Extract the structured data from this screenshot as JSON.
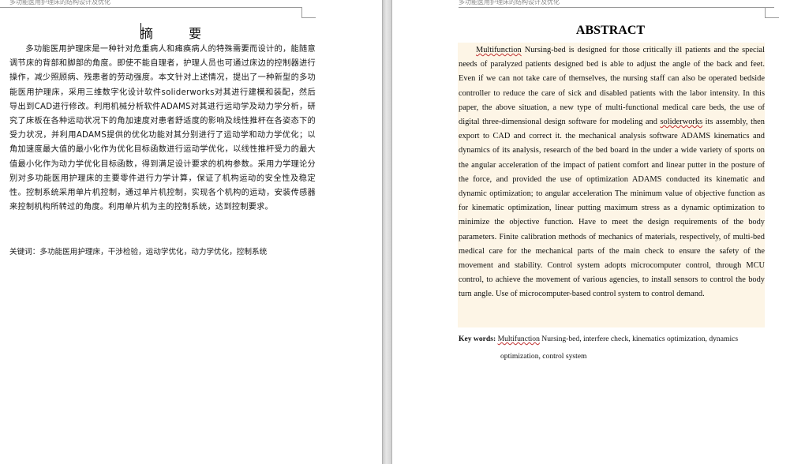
{
  "left_page": {
    "header": "多功能医用护理床的结构设计及优化",
    "title": "摘  要",
    "body": "多功能医用护理床是一种针对危重病人和瘫痪病人的特殊需要而设计的，能随意调节床的背部和脚部的角度。即使不能自理者，护理人员也可通过床边的控制器进行操作，减少照顾病、残患者的劳动强度。本文针对上述情况，提出了一种新型的多功能医用护理床，采用三维数字化设计软件soliderworks对其进行建模和装配，然后导出到CAD进行修改。利用机械分析软件ADAMS对其进行运动学及动力学分析，研究了床板在各种运动状况下的角加速度对患者舒适度的影响及线性推杆在各姿态下的受力状况，并利用ADAMS提供的优化功能对其分别进行了运动学和动力学优化；以角加速度最大值的最小化作为优化目标函数进行运动学优化，以线性推杆受力的最大值最小化作为动力学优化目标函数，得到满足设计要求的机构参数。采用力学理论分别对多功能医用护理床的主要零件进行力学计算，保证了机构运动的安全性及稳定性。控制系统采用单片机控制，通过单片机控制，实现各个机构的运动，安装传感器来控制机构所转过的角度。利用单片机为主的控制系统，达到控制要求。",
    "keywords": "关键词：多功能医用护理床，干涉检验，运动学优化，动力学优化，控制系统"
  },
  "right_page": {
    "header": "多功能医用护理床的结构设计及优化",
    "title": "ABSTRACT",
    "body_first_word": "Multifunction",
    "body_rest_1": " Nursing-bed is designed for those critically ill patients and the special needs of paralyzed patients designed bed is able to adjust the angle of the back and feet. Even if we can not take care of themselves, the nursing staff can also be operated bedside controller to reduce the care of sick and disabled patients with the labor intensity. In this paper, the above situation, a new type of multi-functional medical care beds, the use of digital three-dimensional design software for modeling and ",
    "body_word_2": "soliderworks",
    "body_rest_2": " its assembly, then export to CAD and correct it. the mechanical analysis software ADAMS kinematics and dynamics of its analysis, research of the bed board in the under a wide variety of sports on the angular acceleration of the impact of patient comfort and linear putter in the posture of the force, and provided the use of optimization ADAMS conducted its kinematic and dynamic optimization; to angular acceleration The minimum value of objective function as for kinematic optimization, linear putting maximum stress as a dynamic optimization to minimize the objective function. Have to meet the design requirements of the body parameters. Finite calibration methods of mechanics of materials, respectively, of multi-bed medical care for the mechanical parts of the main check to ensure the safety of the movement and stability. Control system adopts microcomputer control, through MCU control, to achieve the movement of various agencies, to install sensors to control the body turn angle. Use of microcomputer-based control system to control demand.",
    "keywords_label": "Key words:",
    "keywords_first": "Multifunction",
    "keywords_rest": " Nursing-bed, interfere check, kinematics optimization, dynamics",
    "keywords_cont": "optimization, control system"
  },
  "colors": {
    "selection_highlight": "#fdf5e6",
    "spellcheck": "#c03030",
    "gutter": "#d2d2d2"
  }
}
